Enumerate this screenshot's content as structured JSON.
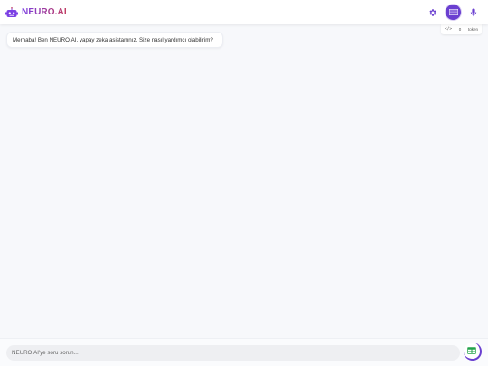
{
  "brand": {
    "name": "NEURO.AI",
    "gradient_start": "#7b3fe4",
    "gradient_end": "#c0395e"
  },
  "header": {
    "icons": [
      "robot-logo-icon",
      "settings-icon",
      "keyboard-icon",
      "microphone-icon"
    ],
    "accent": "#6a3fd0"
  },
  "token_counter": {
    "code_symbol": "</>",
    "count": "0",
    "label": "token"
  },
  "chat": {
    "messages": [
      {
        "role": "assistant",
        "text": "Merhaba! Ben NEURO.AI, yapay zeka asistanınız. Size nasıl yardımcı olabilirim?"
      }
    ]
  },
  "composer": {
    "placeholder": "NEURO.AI'ye soru sorun...",
    "value": "",
    "action_icon": "grid-table-icon",
    "action_color": "#22a34a"
  }
}
